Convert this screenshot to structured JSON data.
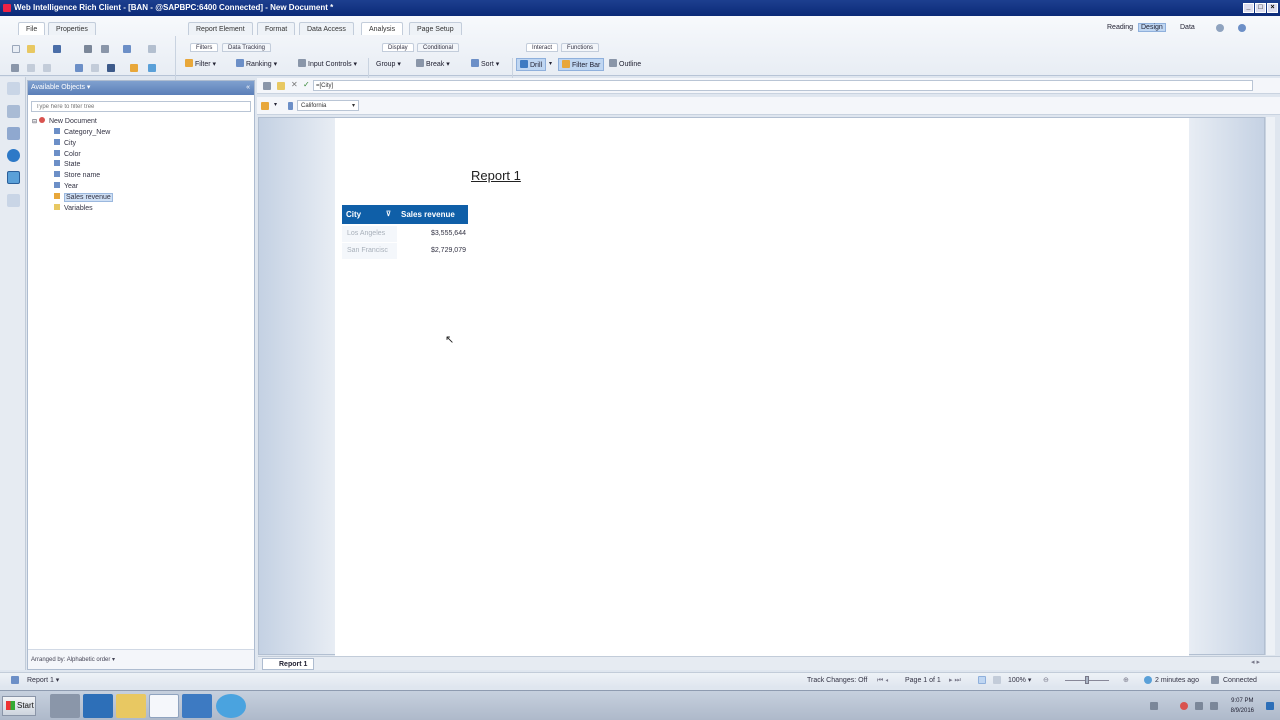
{
  "window": {
    "title": "Web Intelligence Rich Client - [BAN - @SAPBPC:6400 Connected] - New Document *"
  },
  "ribbon": {
    "tabs_left": [
      "File",
      "Properties"
    ],
    "tabs_main": [
      "Report Element",
      "Format",
      "Data Access",
      "Analysis",
      "Page Setup"
    ],
    "active_tab": "Analysis",
    "modes": {
      "reading": "Reading",
      "design": "Design",
      "data": "Data"
    },
    "subtabs": {
      "filters": "Filters",
      "data_tracking": "Data Tracking",
      "display": "Display",
      "conditional": "Conditional",
      "interact": "Interact",
      "functions": "Functions"
    },
    "buttons": {
      "filter": "Filter",
      "ranking": "Ranking",
      "input_controls": "Input Controls",
      "group": "Group",
      "break": "Break",
      "sort": "Sort",
      "drill": "Drill",
      "filter_bar": "Filter Bar",
      "outline": "Outline"
    }
  },
  "objects_panel": {
    "header": "Available Objects",
    "filter_placeholder": "Type here to filter tree",
    "root": "New Document",
    "items": [
      "Category_New",
      "City",
      "Color",
      "State",
      "Store name",
      "Year",
      "Sales revenue",
      "Variables"
    ],
    "selected": "Sales revenue",
    "arranged_by": "Arranged by: Alphabetic order"
  },
  "formula_bar": {
    "value": "=[City]"
  },
  "filter_bar": {
    "selected": "California"
  },
  "report": {
    "title": "Report 1",
    "table": {
      "headers": [
        "City",
        "Sales revenue"
      ],
      "rows": [
        [
          "Los Angeles",
          "$3,555,644"
        ],
        [
          "San Francisc",
          "$2,729,079"
        ]
      ]
    },
    "tab_label": "Report 1"
  },
  "status_bar": {
    "report": "Report 1",
    "track_changes": "Track Changes: Off",
    "page": "Page 1 of 1",
    "zoom": "100%",
    "refreshed": "2 minutes ago",
    "connection": "Connected"
  },
  "taskbar": {
    "start": "Start",
    "time": "9:07 PM",
    "date": "8/9/2016"
  },
  "colors": {
    "header_blue": "#0f5fa8",
    "titlebar": "#0b2a78"
  }
}
